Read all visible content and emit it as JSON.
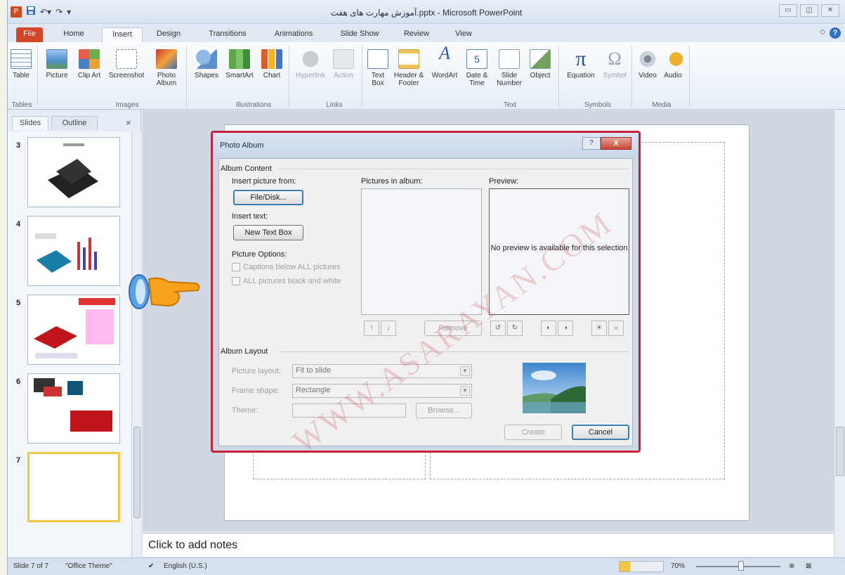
{
  "window": {
    "title": "آموزش مهارت های هفت.pptx - Microsoft PowerPoint",
    "ribbon_minimize": "◇"
  },
  "tabs": [
    "File",
    "Home",
    "Insert",
    "Design",
    "Transitions",
    "Animations",
    "Slide Show",
    "Review",
    "View"
  ],
  "ribbon": {
    "buttons": {
      "table": "Table",
      "picture": "Picture",
      "clip_art": "Clip Art",
      "screenshot": "Screenshot",
      "photo_album": "Photo Album",
      "shapes": "Shapes",
      "smartart": "SmartArt",
      "chart": "Chart",
      "hyperlink": "Hyperlink",
      "action": "Action",
      "text_box": "Text Box",
      "header_footer": "Header & Footer",
      "wordart": "WordArt",
      "date_time": "Date & Time",
      "slide_number": "Slide Number",
      "object": "Object",
      "equation": "Equation",
      "symbol": "Symbol",
      "video": "Video",
      "audio": "Audio"
    },
    "groups": {
      "tables": "Tables",
      "images": "Images",
      "illustrations": "Illustrations",
      "links": "Links",
      "text": "Text",
      "symbols": "Symbols",
      "media": "Media"
    }
  },
  "pane": {
    "tab_slides": "Slides",
    "tab_outline": "Outline",
    "close": "×",
    "slide_numbers": [
      "3",
      "4",
      "5",
      "6",
      "7"
    ]
  },
  "notes": {
    "placeholder": "Click to add notes"
  },
  "status": {
    "slide": "Slide 7 of 7",
    "theme": "\"Office Theme\"",
    "language": "English (U.S.)",
    "zoom": "70%"
  },
  "dialog": {
    "title": "Photo Album",
    "help": "?",
    "close": "X",
    "album_content": "Album Content",
    "insert_picture_from": "Insert picture from:",
    "file_disk": "File/Disk...",
    "insert_text": "Insert text:",
    "new_text_box": "New Text Box",
    "picture_options": "Picture Options:",
    "captions_below": "Captions below ALL pictures",
    "black_white": "ALL pictures black and white",
    "pictures_in_album": "Pictures in album:",
    "preview": "Preview:",
    "no_preview": "No preview is available for this selection",
    "up": "↑",
    "down": "↓",
    "remove": "Remove",
    "album_layout": "Album Layout",
    "picture_layout_label": "Picture layout:",
    "picture_layout_value": "Fit to slide",
    "frame_shape_label": "Frame shape:",
    "frame_shape_value": "Rectangle",
    "theme_label": "Theme:",
    "theme_value": "",
    "browse": "Browse...",
    "create": "Create",
    "cancel": "Cancel"
  },
  "watermark": "WWW.ASARAYAN.COM",
  "colors": {
    "file_tab": "#d24726",
    "dialog_highlight": "#c8203a",
    "selected_slide_border": "#f2c640"
  }
}
